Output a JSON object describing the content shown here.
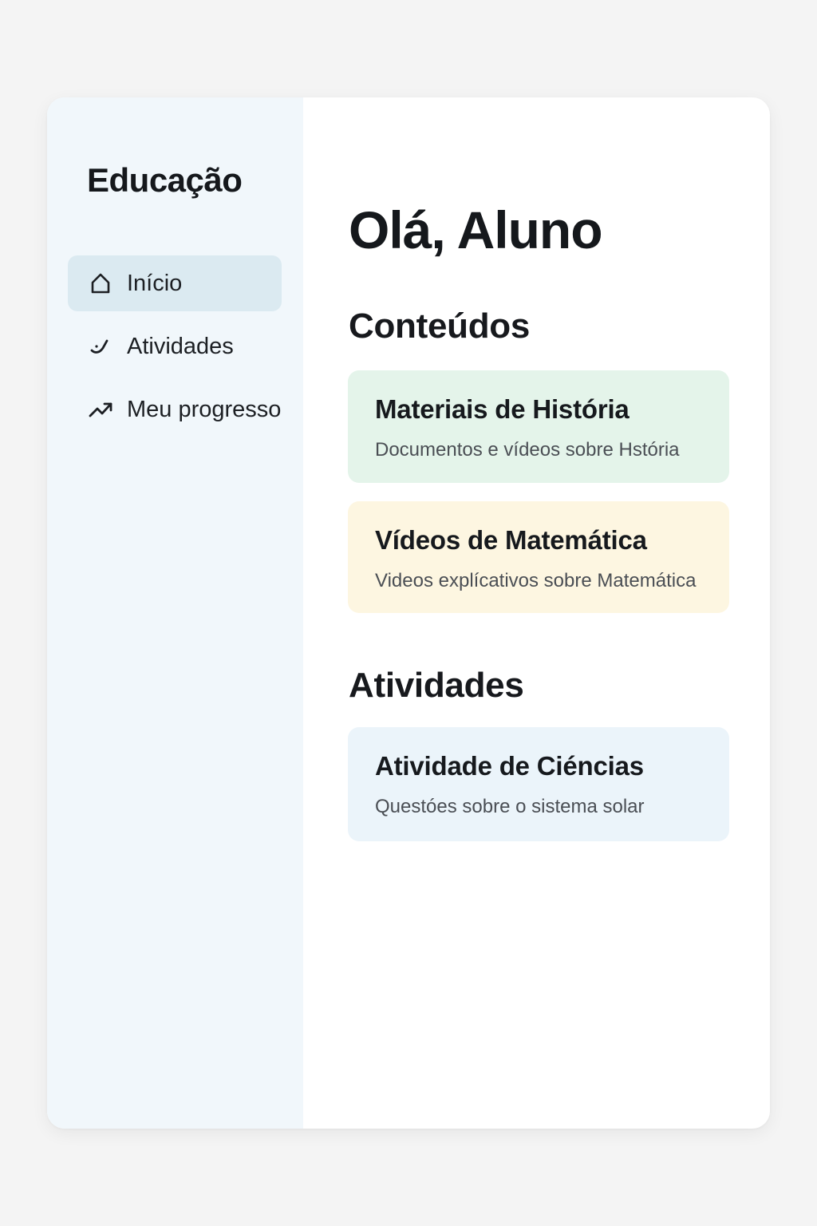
{
  "sidebar": {
    "brand": "Educação",
    "items": [
      {
        "label": "Início",
        "icon": "home-icon",
        "active": true
      },
      {
        "label": "Atividades",
        "icon": "activity-icon",
        "active": false
      },
      {
        "label": "Meu progresso",
        "icon": "trending-up-icon",
        "active": false
      }
    ]
  },
  "main": {
    "greeting": "Olá, Aluno",
    "contents_title": "Conteúdos",
    "contents": [
      {
        "title": "Materiais de História",
        "description": "Documentos e vídeos sobre Hstória",
        "color": "#e4f4ea"
      },
      {
        "title": "Vídeos de Matemática",
        "description": "Videos explícativos sobre Matemática",
        "color": "#fdf6e1"
      }
    ],
    "activities_title": "Atividades",
    "activities": [
      {
        "title": "Atividade de Ciéncias",
        "description": "Questóes sobre o sistema solar",
        "color": "#ebf4fa"
      }
    ]
  },
  "colors": {
    "sidebar_bg": "#f1f7fb",
    "active_item_bg": "#dbeaf1",
    "page_bg": "#f4f4f4"
  }
}
